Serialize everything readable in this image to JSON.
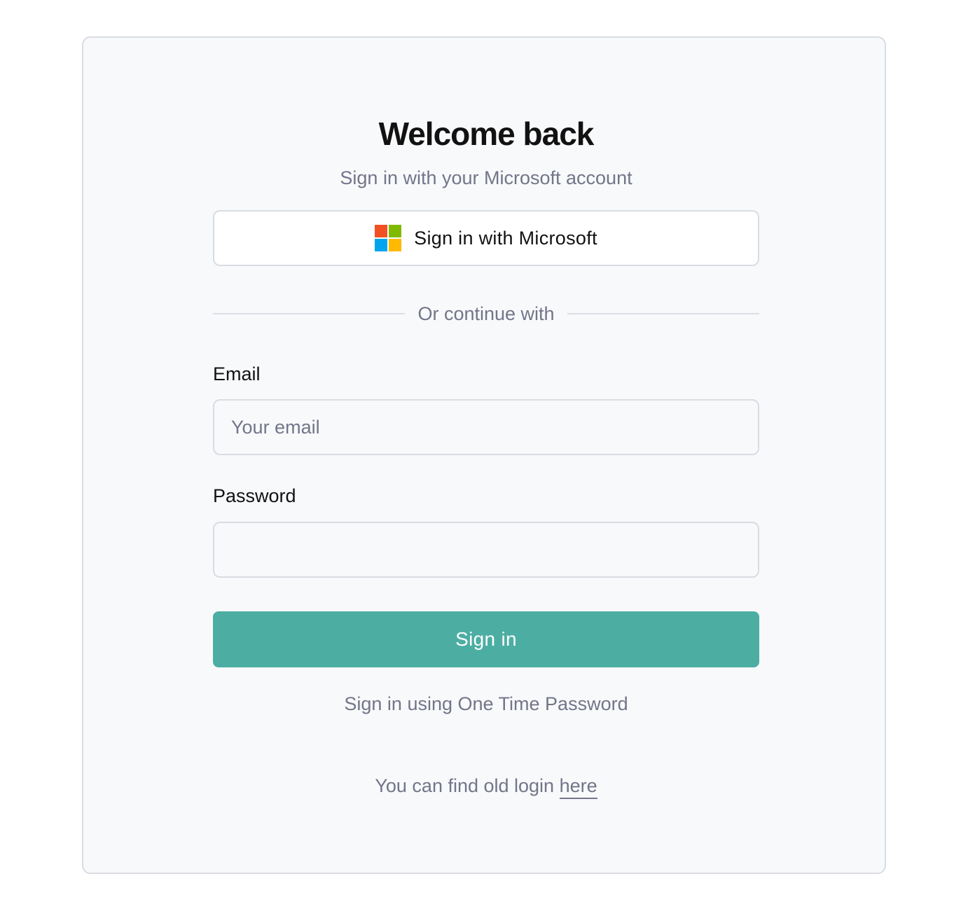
{
  "header": {
    "title": "Welcome back",
    "subtitle": "Sign in with your Microsoft account"
  },
  "microsoft_button": {
    "label": "Sign in with Microsoft",
    "icon": "microsoft-logo-icon",
    "logo_colors": [
      "#f25022",
      "#7fba00",
      "#00a4ef",
      "#ffb900"
    ]
  },
  "divider": {
    "label": "Or continue with"
  },
  "form": {
    "email_label": "Email",
    "email_placeholder": "Your email",
    "email_value": "",
    "password_label": "Password",
    "password_value": "",
    "submit_label": "Sign in"
  },
  "footer": {
    "otp_link": "Sign in using One Time Password",
    "old_login_text": "You can find old login",
    "old_login_link": "here"
  },
  "colors": {
    "accent": "#4caea3",
    "muted_text": "#737589",
    "card_background": "#f8f9fb",
    "border": "#d9dce2"
  }
}
